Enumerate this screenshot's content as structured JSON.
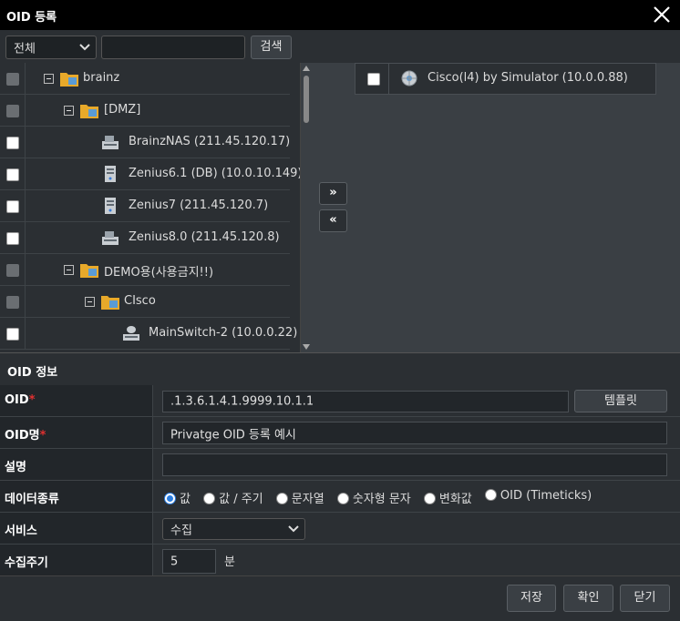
{
  "window": {
    "title": "OID 등록",
    "close_icon": "close-icon"
  },
  "search": {
    "scope_value": "전체",
    "input_value": "",
    "search_label": "검색"
  },
  "tree": [
    {
      "label": "brainz",
      "icon": "folder-icon",
      "disabled": true
    },
    {
      "label": "[DMZ]",
      "icon": "folder-icon",
      "disabled": true
    },
    {
      "label": "BrainzNAS (211.45.120.17)",
      "icon": "nas-device-icon",
      "disabled": false
    },
    {
      "label": "Zenius6.1 (DB) (10.0.10.149)",
      "icon": "server-icon",
      "disabled": false
    },
    {
      "label": "Zenius7 (211.45.120.7)",
      "icon": "server-icon",
      "disabled": false
    },
    {
      "label": "Zenius8.0 (211.45.120.8)",
      "icon": "nas-device-icon",
      "disabled": false
    },
    {
      "label": "DEMO용(사용금지!!)",
      "icon": "folder-icon",
      "disabled": true
    },
    {
      "label": "CIsco",
      "icon": "folder-icon",
      "disabled": true
    },
    {
      "label": "MainSwitch-2 (10.0.0.22)",
      "icon": "switch-icon",
      "disabled": false
    }
  ],
  "transfer": {
    "add_label": "»",
    "remove_label": "«"
  },
  "target": {
    "items": [
      {
        "label": "Cisco(l4) by Simulator (10.0.0.88)",
        "icon": "simulator-icon"
      }
    ]
  },
  "oid_info": {
    "section_title": "OID 정보",
    "oid_label": "OID",
    "oid_value": ".1.3.6.1.4.1.9999.10.1.1",
    "template_label": "템플릿",
    "name_label": "OID명",
    "name_value": "Privatge OID 등록 예시",
    "desc_label": "설명",
    "desc_value": "",
    "datatype_label": "데이터종류",
    "datatypes": [
      "값",
      "값 / 주기",
      "문자열",
      "숫자형 문자",
      "변화값",
      "OID (Timeticks)"
    ],
    "datatype_selected": "값",
    "service_label": "서비스",
    "service_value": "수집",
    "interval_label": "수집주기",
    "interval_value": "5",
    "interval_unit": "분",
    "required_mark": "*"
  },
  "footer": {
    "save_label": "저장",
    "ok_label": "확인",
    "close_label": "닫기"
  },
  "colors": {
    "background": "#2b2f33",
    "titlebar": "#000000",
    "required": "#e03030",
    "radio_accent": "#2a7de1",
    "folder": "#e8a92a"
  }
}
